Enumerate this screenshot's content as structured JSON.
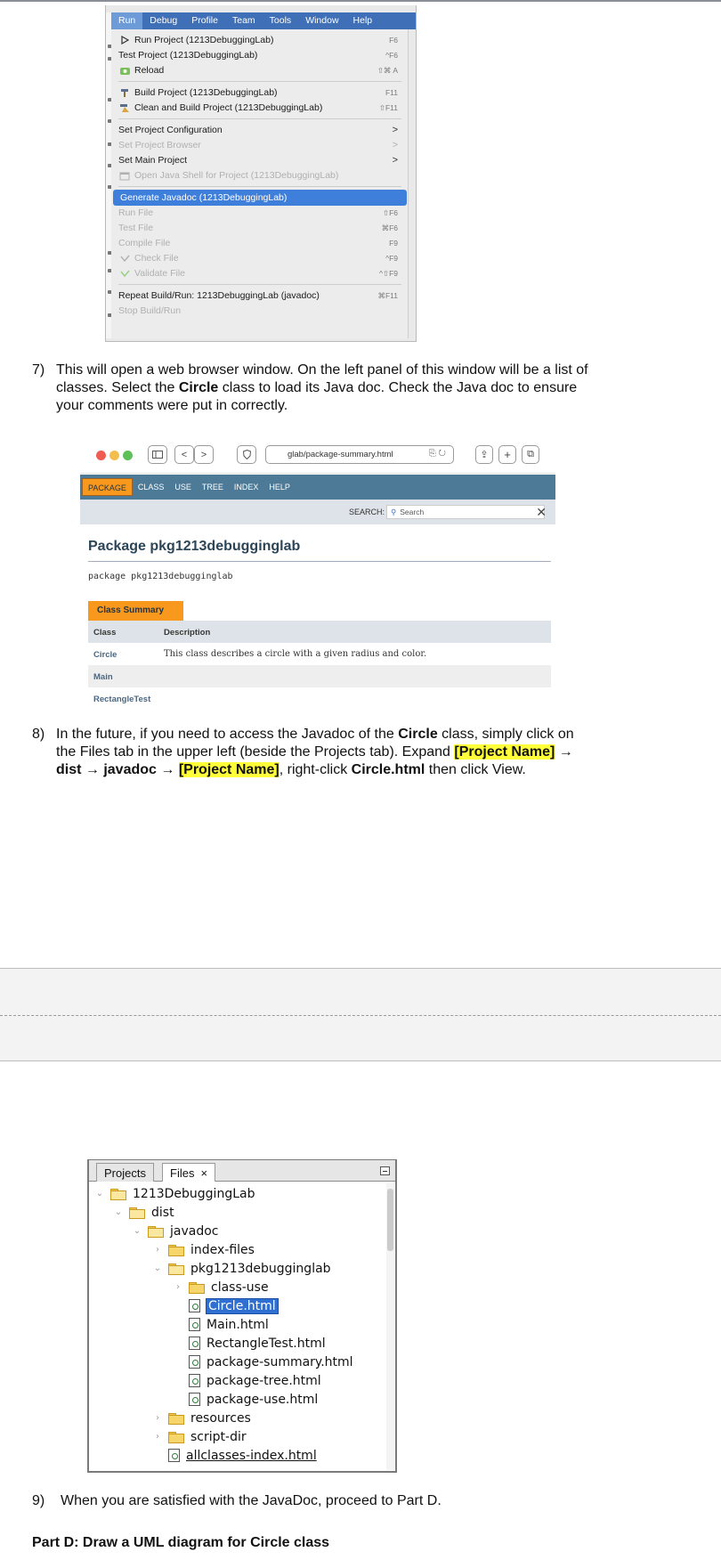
{
  "menu": {
    "bar": [
      "Run",
      "Debug",
      "Profile",
      "Team",
      "Tools",
      "Window",
      "Help"
    ],
    "items": [
      {
        "label": "Run Project (1213DebuggingLab)",
        "shortcut": "F6",
        "icon": "run-triangle-icon"
      },
      {
        "label": "Test Project (1213DebuggingLab)",
        "shortcut": "^F6",
        "icon": ""
      },
      {
        "label": "Reload",
        "shortcut": "⇧⌘ A",
        "icon": "reload-icon"
      },
      {
        "label": "Build Project (1213DebuggingLab)",
        "shortcut": "F11",
        "icon": "hammer-icon"
      },
      {
        "label": "Clean and Build Project (1213DebuggingLab)",
        "shortcut": "⇧F11",
        "icon": "broom-icon"
      },
      {
        "label": "Set Project Configuration",
        "shortcut": ">",
        "icon": ""
      },
      {
        "label": "Set Project Browser",
        "shortcut": ">",
        "icon": ""
      },
      {
        "label": "Set Main Project",
        "shortcut": ">",
        "icon": ""
      },
      {
        "label": "Open Java Shell for Project (1213DebuggingLab)",
        "shortcut": "",
        "icon": "java-shell-icon"
      },
      {
        "label": "Generate Javadoc (1213DebuggingLab)",
        "shortcut": "",
        "icon": ""
      },
      {
        "label": "Run File",
        "shortcut": "⇧F6",
        "icon": ""
      },
      {
        "label": "Test File",
        "shortcut": "⌘F6",
        "icon": ""
      },
      {
        "label": "Compile File",
        "shortcut": "F9",
        "icon": ""
      },
      {
        "label": "Check File",
        "shortcut": "^F9",
        "icon": "check-icon"
      },
      {
        "label": "Validate File",
        "shortcut": "^⇧F9",
        "icon": "validate-icon"
      },
      {
        "label": "Repeat Build/Run: 1213DebuggingLab (javadoc)",
        "shortcut": "⌘F11",
        "icon": ""
      },
      {
        "label": "Stop Build/Run",
        "shortcut": "",
        "icon": ""
      }
    ]
  },
  "steps": {
    "s7": {
      "num": "7)",
      "l1": "This will open a web browser window. On the left panel of this window will be a list of",
      "l2a": "classes. Select the ",
      "l2b": "Circle",
      "l2c": " class to load its Java doc. Check the Java doc to ensure",
      "l3": "your comments were put in correctly."
    },
    "s8": {
      "num": "8)",
      "l1a": "In the future, if you need to access the Javadoc of the ",
      "l1b": "Circle",
      "l1c": " class, simply click on",
      "l2a": "the Files tab in the upper left (beside the Projects tab). Expand ",
      "l2b": "[Project Name]",
      "l2c": " →",
      "l3a": "dist → javadoc → ",
      "l3b": "[Project Name]",
      "l3c": ", right-click ",
      "l3d": "Circle.html",
      "l3e": " then click View."
    },
    "s9": {
      "num": "9)",
      "text": "When you are satisfied with the JavaDoc, proceed to Part  D."
    },
    "partD": "Part D: Draw a UML diagram for Circle class"
  },
  "browser": {
    "url": "glab/package-summary.html",
    "nav": [
      "PACKAGE",
      "CLASS",
      "USE",
      "TREE",
      "INDEX",
      "HELP"
    ],
    "search_label": "SEARCH:",
    "search_placeholder": "Search",
    "package_title": "Package pkg1213debugginglab",
    "package_decl": "package pkg1213debugginglab",
    "summary_tab": "Class Summary",
    "table_headers": [
      "Class",
      "Description"
    ],
    "rows": [
      {
        "cls": "Circle",
        "desc": "This class describes a circle with a given radius and color."
      },
      {
        "cls": "Main",
        "desc": ""
      },
      {
        "cls": "RectangleTest",
        "desc": ""
      }
    ]
  },
  "files_panel": {
    "tabs": [
      "Projects",
      "Files"
    ],
    "tree": [
      {
        "label": "1213DebuggingLab",
        "type": "folder",
        "depth": 0,
        "open": true
      },
      {
        "label": "dist",
        "type": "folder",
        "depth": 1,
        "open": true
      },
      {
        "label": "javadoc",
        "type": "folder",
        "depth": 2,
        "open": true
      },
      {
        "label": "index-files",
        "type": "folder",
        "depth": 3,
        "open": false
      },
      {
        "label": "pkg1213debugginglab",
        "type": "folder",
        "depth": 3,
        "open": true
      },
      {
        "label": "class-use",
        "type": "folder",
        "depth": 4,
        "open": false
      },
      {
        "label": "Circle.html",
        "type": "file",
        "depth": 4,
        "selected": true
      },
      {
        "label": "Main.html",
        "type": "file",
        "depth": 4
      },
      {
        "label": "RectangleTest.html",
        "type": "file",
        "depth": 4
      },
      {
        "label": "package-summary.html",
        "type": "file",
        "depth": 4
      },
      {
        "label": "package-tree.html",
        "type": "file",
        "depth": 4
      },
      {
        "label": "package-use.html",
        "type": "file",
        "depth": 4
      },
      {
        "label": "resources",
        "type": "folder",
        "depth": 3,
        "open": false
      },
      {
        "label": "script-dir",
        "type": "folder",
        "depth": 3,
        "open": false
      },
      {
        "label": "allclasses-index.html",
        "type": "file",
        "depth": 3
      }
    ]
  }
}
